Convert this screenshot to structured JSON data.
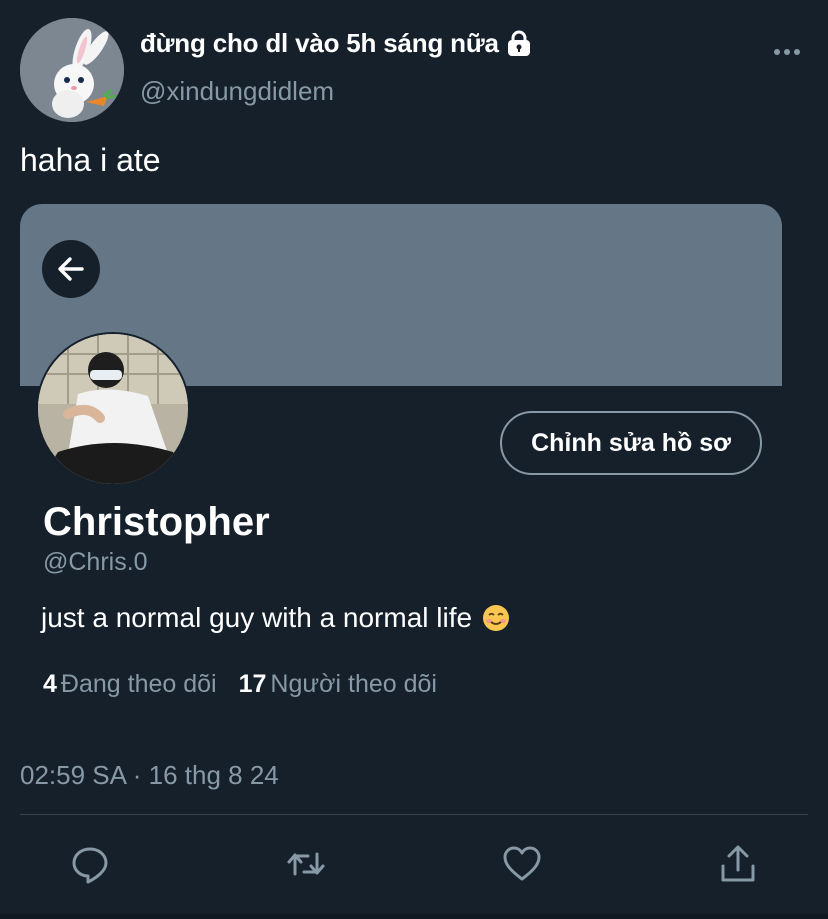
{
  "tweet": {
    "author": {
      "display_name": "đừng cho dl vào 5h sáng nữa",
      "handle": "@xindungdidlem",
      "avatar_icon": "bunny-avatar",
      "protected_icon": "lock-icon"
    },
    "text": "haha i ate",
    "timestamp": "02:59 SA · 16 thg 8 24"
  },
  "embedded_profile": {
    "back_icon": "arrow-left-icon",
    "banner_color": "#657786",
    "edit_button_label": "Chỉnh sửa hồ sơ",
    "name": "Christopher",
    "handle": "@Chris.0",
    "bio": "just a normal guy with a normal life",
    "bio_emoji": "smiling-face-icon",
    "following_count": "4",
    "following_label": "Đang theo dõi",
    "followers_count": "17",
    "followers_label": "Người theo dõi"
  },
  "actions": [
    "reply-icon",
    "retweet-icon",
    "like-icon",
    "share-icon"
  ],
  "colors": {
    "background": "#15202b",
    "secondary_text": "#8899a6",
    "divider": "#38444d"
  }
}
